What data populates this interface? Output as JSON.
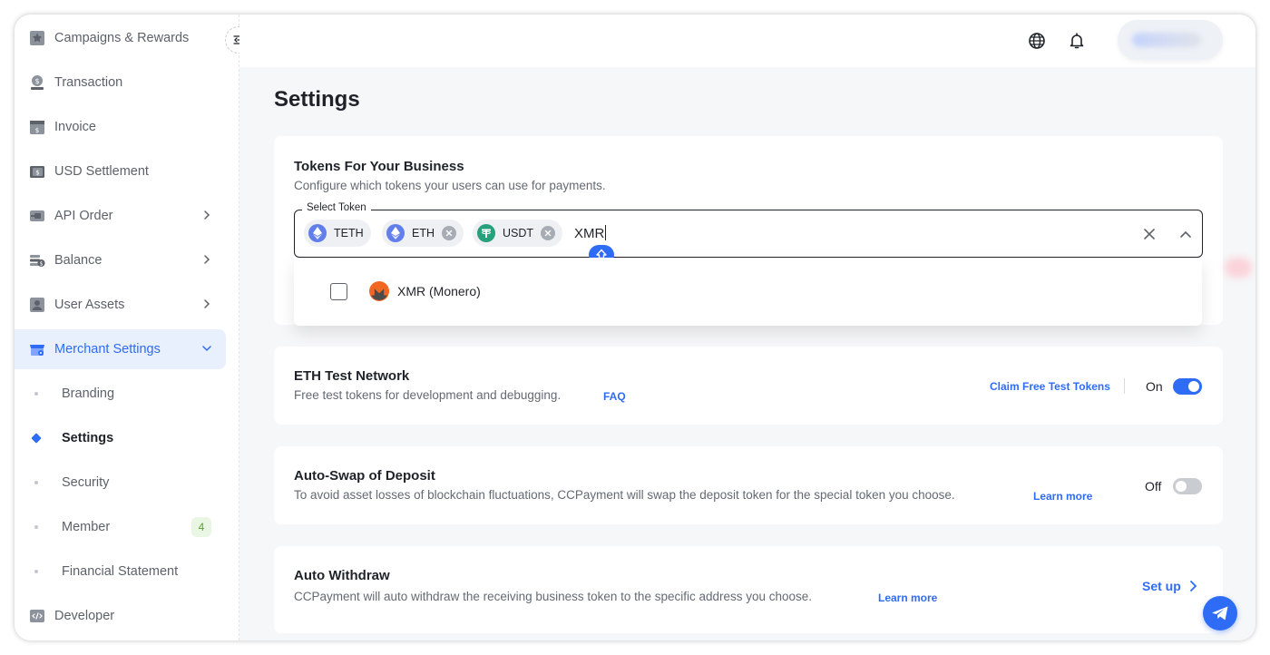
{
  "sidebar": {
    "items": [
      {
        "label": "Campaigns & Rewards",
        "icon": "star-icon"
      },
      {
        "label": "Transaction",
        "icon": "dollar-hand-icon"
      },
      {
        "label": "Invoice",
        "icon": "invoice-icon"
      },
      {
        "label": "USD Settlement",
        "icon": "usd-settlement-icon"
      },
      {
        "label": "API Order",
        "icon": "api-order-icon",
        "has_chevron": true
      },
      {
        "label": "Balance",
        "icon": "balance-icon",
        "has_chevron": true
      },
      {
        "label": "User Assets",
        "icon": "user-assets-icon",
        "has_chevron": true
      },
      {
        "label": "Merchant Settings",
        "icon": "merchant-store-icon",
        "expanded": true,
        "active": true
      },
      {
        "label": "Developer",
        "icon": "code-icon"
      }
    ],
    "sub_items": [
      {
        "label": "Branding"
      },
      {
        "label": "Settings",
        "active": true
      },
      {
        "label": "Security"
      },
      {
        "label": "Member",
        "badge": "4"
      },
      {
        "label": "Financial Statement"
      }
    ]
  },
  "header": {
    "icons": [
      "globe-icon",
      "bell-icon"
    ],
    "user": "avatar (blurred)"
  },
  "page": {
    "title": "Settings"
  },
  "tokens_card": {
    "title": "Tokens For Your Business",
    "description": "Configure which tokens your users can use for payments.",
    "select_label": "Select Token",
    "chips": [
      {
        "label": "TETH",
        "removable": false
      },
      {
        "label": "ETH",
        "removable": true
      },
      {
        "label": "USDT",
        "removable": true
      }
    ],
    "typed_value": "XMR",
    "dropdown_option": "XMR (Monero)"
  },
  "eth_test_card": {
    "title": "ETH Test Network",
    "description": "Free test tokens for development and debugging.",
    "faq_link": "FAQ",
    "claim_link": "Claim Free Test Tokens",
    "toggle_label": "On",
    "toggle_on": true
  },
  "auto_swap_card": {
    "title": "Auto-Swap of Deposit",
    "description": "To avoid asset losses of blockchain fluctuations, CCPayment will swap the deposit token for the special token you choose.",
    "learn_more": "Learn more",
    "toggle_label": "Off",
    "toggle_on": false
  },
  "auto_withdraw_card": {
    "title": "Auto Withdraw",
    "description": "CCPayment will auto withdraw the receiving business token to the specific address you choose.",
    "learn_more": "Learn more",
    "setup_link": "Set up"
  },
  "colors": {
    "accent": "#2f6cf6",
    "eth": "#627eea",
    "usdt": "#26a17b",
    "xmr": "#f26822"
  }
}
